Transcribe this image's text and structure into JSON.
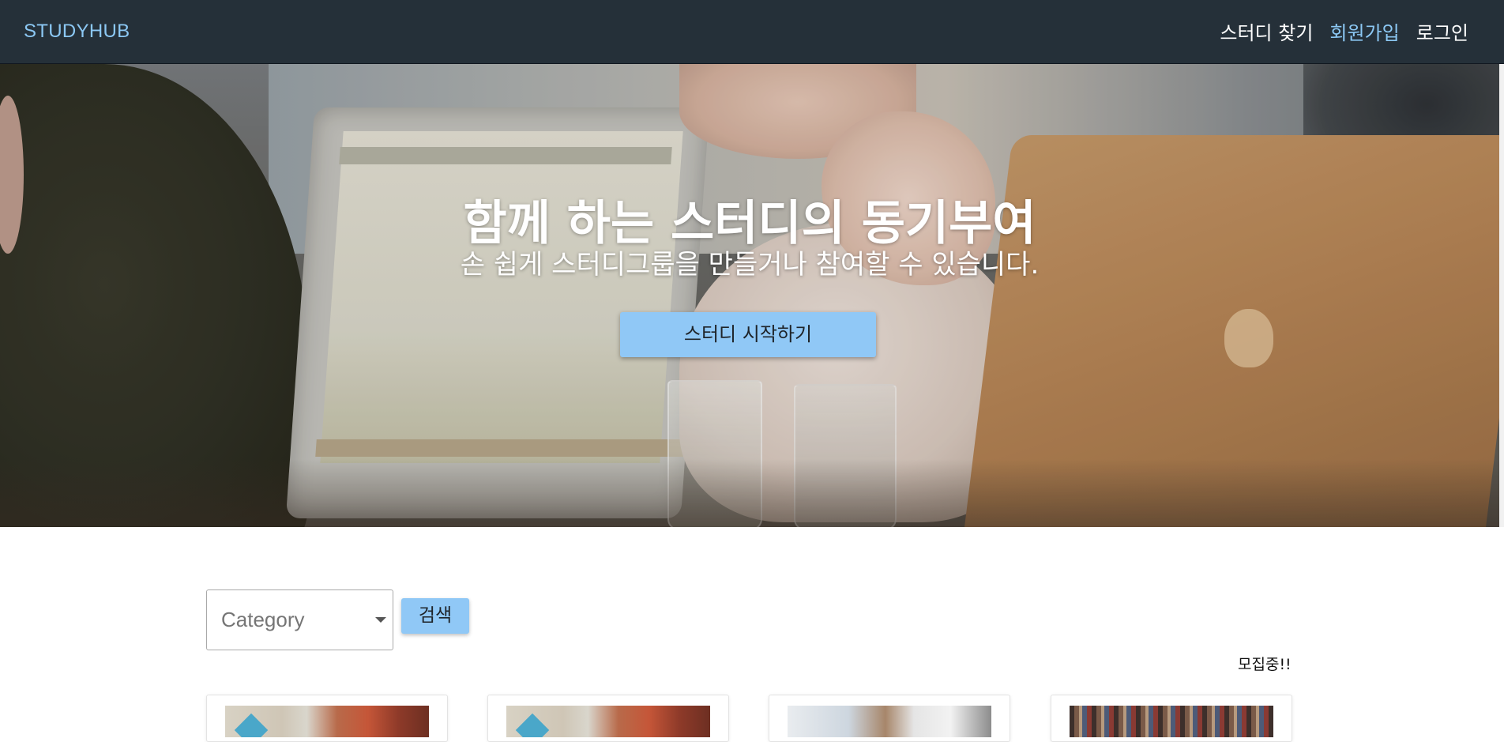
{
  "navbar": {
    "brand": "STUDYHUB",
    "links": [
      {
        "label": "스터디 찾기",
        "accent": false
      },
      {
        "label": "회원가입",
        "accent": true
      },
      {
        "label": "로그인",
        "accent": false
      }
    ]
  },
  "hero": {
    "title": "함께 하는 스터디의 동기부여",
    "subtitle": "손 쉽게 스터디그룹을 만들거나 참여할 수 있습니다.",
    "cta_label": "스터디 시작하기"
  },
  "search": {
    "category_label": "Category",
    "search_button_label": "검색",
    "status_label": "모집중!!"
  },
  "colors": {
    "navbar_bg": "#253039",
    "accent": "#8cc8f4",
    "button_bg": "#90c8f6"
  },
  "cards": [
    {
      "thumbnail": "keyboard-and-books"
    },
    {
      "thumbnail": "keyboard-and-books"
    },
    {
      "thumbnail": "documents-and-laptop"
    },
    {
      "thumbnail": "bookshelf"
    }
  ]
}
